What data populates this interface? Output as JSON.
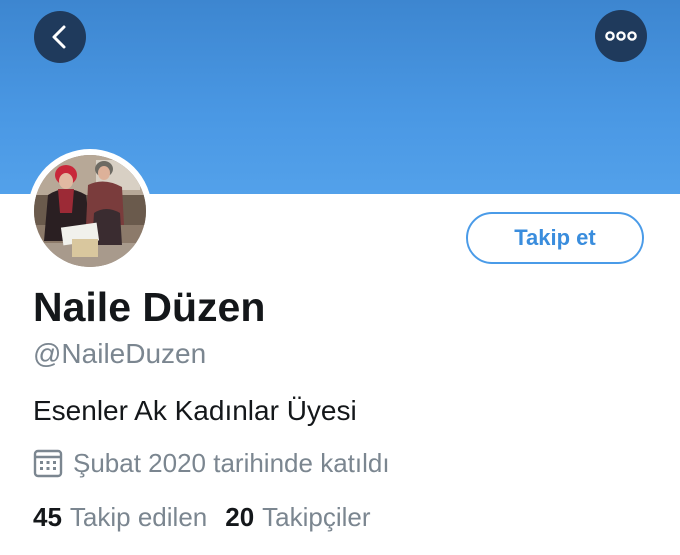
{
  "header": {
    "back_icon": "chevron-left-icon",
    "more_icon": "ellipsis-icon",
    "banner_color": "#4a98e4",
    "button_bg": "#1f3a5c"
  },
  "profile": {
    "name": "Naile Düzen",
    "handle": "@NaileDuzen",
    "bio": "Esenler Ak Kadınlar Üyesi",
    "joined_icon": "calendar-icon",
    "joined_text": "Şubat 2020 tarihinde katıldı",
    "follow_label": "Takip et",
    "accent_color": "#4a9be8"
  },
  "stats": {
    "following_count": "45",
    "following_label": "Takip edilen",
    "followers_count": "20",
    "followers_label": "Takipçiler"
  }
}
